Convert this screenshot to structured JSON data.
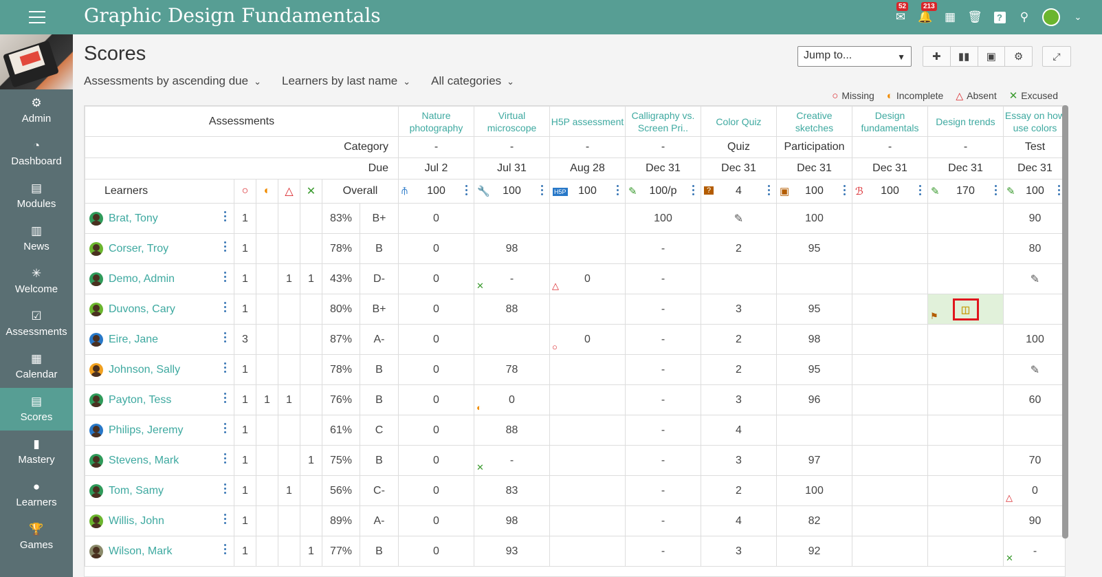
{
  "header": {
    "course_title": "Graphic Design Fundamentals",
    "messages_badge": "52",
    "notifications_badge": "213"
  },
  "sidebar": {
    "items": [
      {
        "label": "Admin",
        "icon": "gear-icon"
      },
      {
        "label": "Dashboard",
        "icon": "gauge-icon"
      },
      {
        "label": "Modules",
        "icon": "modules-icon"
      },
      {
        "label": "News",
        "icon": "news-icon"
      },
      {
        "label": "Welcome",
        "icon": "welcome-icon"
      },
      {
        "label": "Assessments",
        "icon": "assessments-icon"
      },
      {
        "label": "Calendar",
        "icon": "calendar-icon"
      },
      {
        "label": "Scores",
        "icon": "scores-icon",
        "active": true
      },
      {
        "label": "Mastery",
        "icon": "mastery-icon"
      },
      {
        "label": "Learners",
        "icon": "learners-icon"
      },
      {
        "label": "Games",
        "icon": "trophy-icon"
      }
    ]
  },
  "page": {
    "title": "Scores",
    "jump_to": "Jump to...",
    "filters": [
      "Assessments by ascending due",
      "Learners by last name",
      "All categories"
    ]
  },
  "legend": {
    "missing": "Missing",
    "incomplete": "Incomplete",
    "absent": "Absent",
    "excused": "Excused"
  },
  "grid": {
    "labels": {
      "assessments": "Assessments",
      "category": "Category",
      "due": "Due",
      "learners": "Learners",
      "overall": "Overall"
    },
    "assessments": [
      {
        "name": "Nature photography",
        "category": "-",
        "due": "Jul 2",
        "points": "100",
        "icon": "clip-icon"
      },
      {
        "name": "Virtual microscope",
        "category": "-",
        "due": "Jul 31",
        "points": "100",
        "icon": "tool-icon"
      },
      {
        "name": "H5P assessment",
        "category": "-",
        "due": "Aug 28",
        "points": "100",
        "icon": "h5p-icon"
      },
      {
        "name": "Calligraphy vs. Screen Pri..",
        "category": "-",
        "due": "Dec 31",
        "points": "100/p",
        "icon": "calligraphy-icon"
      },
      {
        "name": "Color Quiz",
        "category": "Quiz",
        "due": "Dec 31",
        "points": "4",
        "icon": "quiz-icon"
      },
      {
        "name": "Creative sketches",
        "category": "Participation",
        "due": "Dec 31",
        "points": "100",
        "icon": "participation-icon"
      },
      {
        "name": "Design fundamentals",
        "category": "-",
        "due": "Dec 31",
        "points": "100",
        "icon": "design-icon"
      },
      {
        "name": "Design trends",
        "category": "-",
        "due": "Dec 31",
        "points": "170",
        "icon": "pencil-icon"
      },
      {
        "name": "Essay on how use colors",
        "category": "Test",
        "due": "Dec 31",
        "points": "100",
        "icon": "pencil-icon"
      }
    ],
    "learners": [
      {
        "name": "Brat, Tony",
        "missing": "1",
        "incomplete": "",
        "absent": "",
        "excused": "",
        "overall": "83%",
        "grade": "B+",
        "scores": [
          "0",
          "",
          "",
          "100",
          "",
          "100",
          "",
          "",
          "90"
        ],
        "flags": [
          "",
          "",
          "",
          "",
          "pencil",
          "",
          "",
          "",
          ""
        ],
        "avatar": "#2f9a5a"
      },
      {
        "name": "Corser, Troy",
        "missing": "1",
        "incomplete": "",
        "absent": "",
        "excused": "",
        "overall": "78%",
        "grade": "B",
        "scores": [
          "0",
          "98",
          "",
          "-",
          "2",
          "95",
          "",
          "",
          "80"
        ],
        "flags": [
          "",
          "",
          "",
          "",
          "",
          "",
          "",
          "",
          ""
        ],
        "avatar": "#6bb52e"
      },
      {
        "name": "Demo, Admin",
        "missing": "1",
        "incomplete": "",
        "absent": "1",
        "excused": "1",
        "overall": "43%",
        "grade": "D-",
        "scores": [
          "0",
          "-",
          "0",
          "-",
          "",
          "",
          "",
          "",
          ""
        ],
        "flags": [
          "",
          "excused",
          "absent",
          "",
          "",
          "",
          "",
          "",
          "pencil"
        ],
        "avatar": "#2f9a5a"
      },
      {
        "name": "Duvons, Cary",
        "missing": "1",
        "incomplete": "",
        "absent": "",
        "excused": "",
        "overall": "80%",
        "grade": "B+",
        "scores": [
          "0",
          "88",
          "",
          "-",
          "3",
          "95",
          "",
          "",
          ""
        ],
        "flags": [
          "",
          "",
          "",
          "",
          "",
          "",
          "",
          "highlight",
          ""
        ],
        "avatar": "#6bb52e"
      },
      {
        "name": "Eire, Jane",
        "missing": "3",
        "incomplete": "",
        "absent": "",
        "excused": "",
        "overall": "87%",
        "grade": "A-",
        "scores": [
          "0",
          "",
          "0",
          "-",
          "2",
          "98",
          "",
          "",
          "100"
        ],
        "flags": [
          "",
          "",
          "missing",
          "",
          "",
          "",
          "",
          "",
          ""
        ],
        "avatar": "#2878c8"
      },
      {
        "name": "Johnson, Sally",
        "missing": "1",
        "incomplete": "",
        "absent": "",
        "excused": "",
        "overall": "78%",
        "grade": "B",
        "scores": [
          "0",
          "78",
          "",
          "-",
          "2",
          "95",
          "",
          "",
          ""
        ],
        "flags": [
          "",
          "",
          "",
          "",
          "",
          "",
          "",
          "",
          "pencil"
        ],
        "avatar": "#f0a020"
      },
      {
        "name": "Payton, Tess",
        "missing": "1",
        "incomplete": "1",
        "absent": "1",
        "excused": "",
        "overall": "76%",
        "grade": "B",
        "scores": [
          "0",
          "0",
          "",
          "-",
          "3",
          "96",
          "",
          "",
          "60"
        ],
        "flags": [
          "",
          "incomplete",
          "",
          "",
          "",
          "",
          "",
          "",
          ""
        ],
        "avatar": "#2f9a5a"
      },
      {
        "name": "Philips, Jeremy",
        "missing": "1",
        "incomplete": "",
        "absent": "",
        "excused": "",
        "overall": "61%",
        "grade": "C",
        "scores": [
          "0",
          "88",
          "",
          "-",
          "4",
          "",
          "",
          "",
          ""
        ],
        "flags": [
          "",
          "",
          "",
          "",
          "",
          "",
          "",
          "",
          ""
        ],
        "avatar": "#2878c8"
      },
      {
        "name": "Stevens, Mark",
        "missing": "1",
        "incomplete": "",
        "absent": "",
        "excused": "1",
        "overall": "75%",
        "grade": "B",
        "scores": [
          "0",
          "-",
          "",
          "-",
          "3",
          "97",
          "",
          "",
          "70"
        ],
        "flags": [
          "",
          "excused",
          "",
          "",
          "",
          "",
          "",
          "",
          ""
        ],
        "avatar": "#2f9a5a"
      },
      {
        "name": "Tom, Samy",
        "missing": "1",
        "incomplete": "",
        "absent": "1",
        "excused": "",
        "overall": "56%",
        "grade": "C-",
        "scores": [
          "0",
          "83",
          "",
          "-",
          "2",
          "100",
          "",
          "",
          "0"
        ],
        "flags": [
          "",
          "",
          "",
          "",
          "",
          "",
          "",
          "",
          "absent"
        ],
        "avatar": "#2f9a5a"
      },
      {
        "name": "Willis, John",
        "missing": "1",
        "incomplete": "",
        "absent": "",
        "excused": "",
        "overall": "89%",
        "grade": "A-",
        "scores": [
          "0",
          "98",
          "",
          "-",
          "4",
          "82",
          "",
          "",
          "90"
        ],
        "flags": [
          "",
          "",
          "",
          "",
          "",
          "",
          "",
          "",
          ""
        ],
        "avatar": "#6bb52e"
      },
      {
        "name": "Wilson, Mark",
        "missing": "1",
        "incomplete": "",
        "absent": "",
        "excused": "1",
        "overall": "77%",
        "grade": "B",
        "scores": [
          "0",
          "93",
          "",
          "-",
          "3",
          "92",
          "",
          "",
          "-"
        ],
        "flags": [
          "",
          "",
          "",
          "",
          "",
          "",
          "",
          "",
          "excused"
        ],
        "avatar": "#8a8a6a"
      }
    ]
  },
  "colors": {
    "brand": "#579e94",
    "sidebar": "#5a6f73",
    "link": "#3ea9a0",
    "missing": "#d9252a",
    "incomplete": "#f08c00",
    "absent": "#d9252a",
    "excused": "#3a9a2e"
  }
}
